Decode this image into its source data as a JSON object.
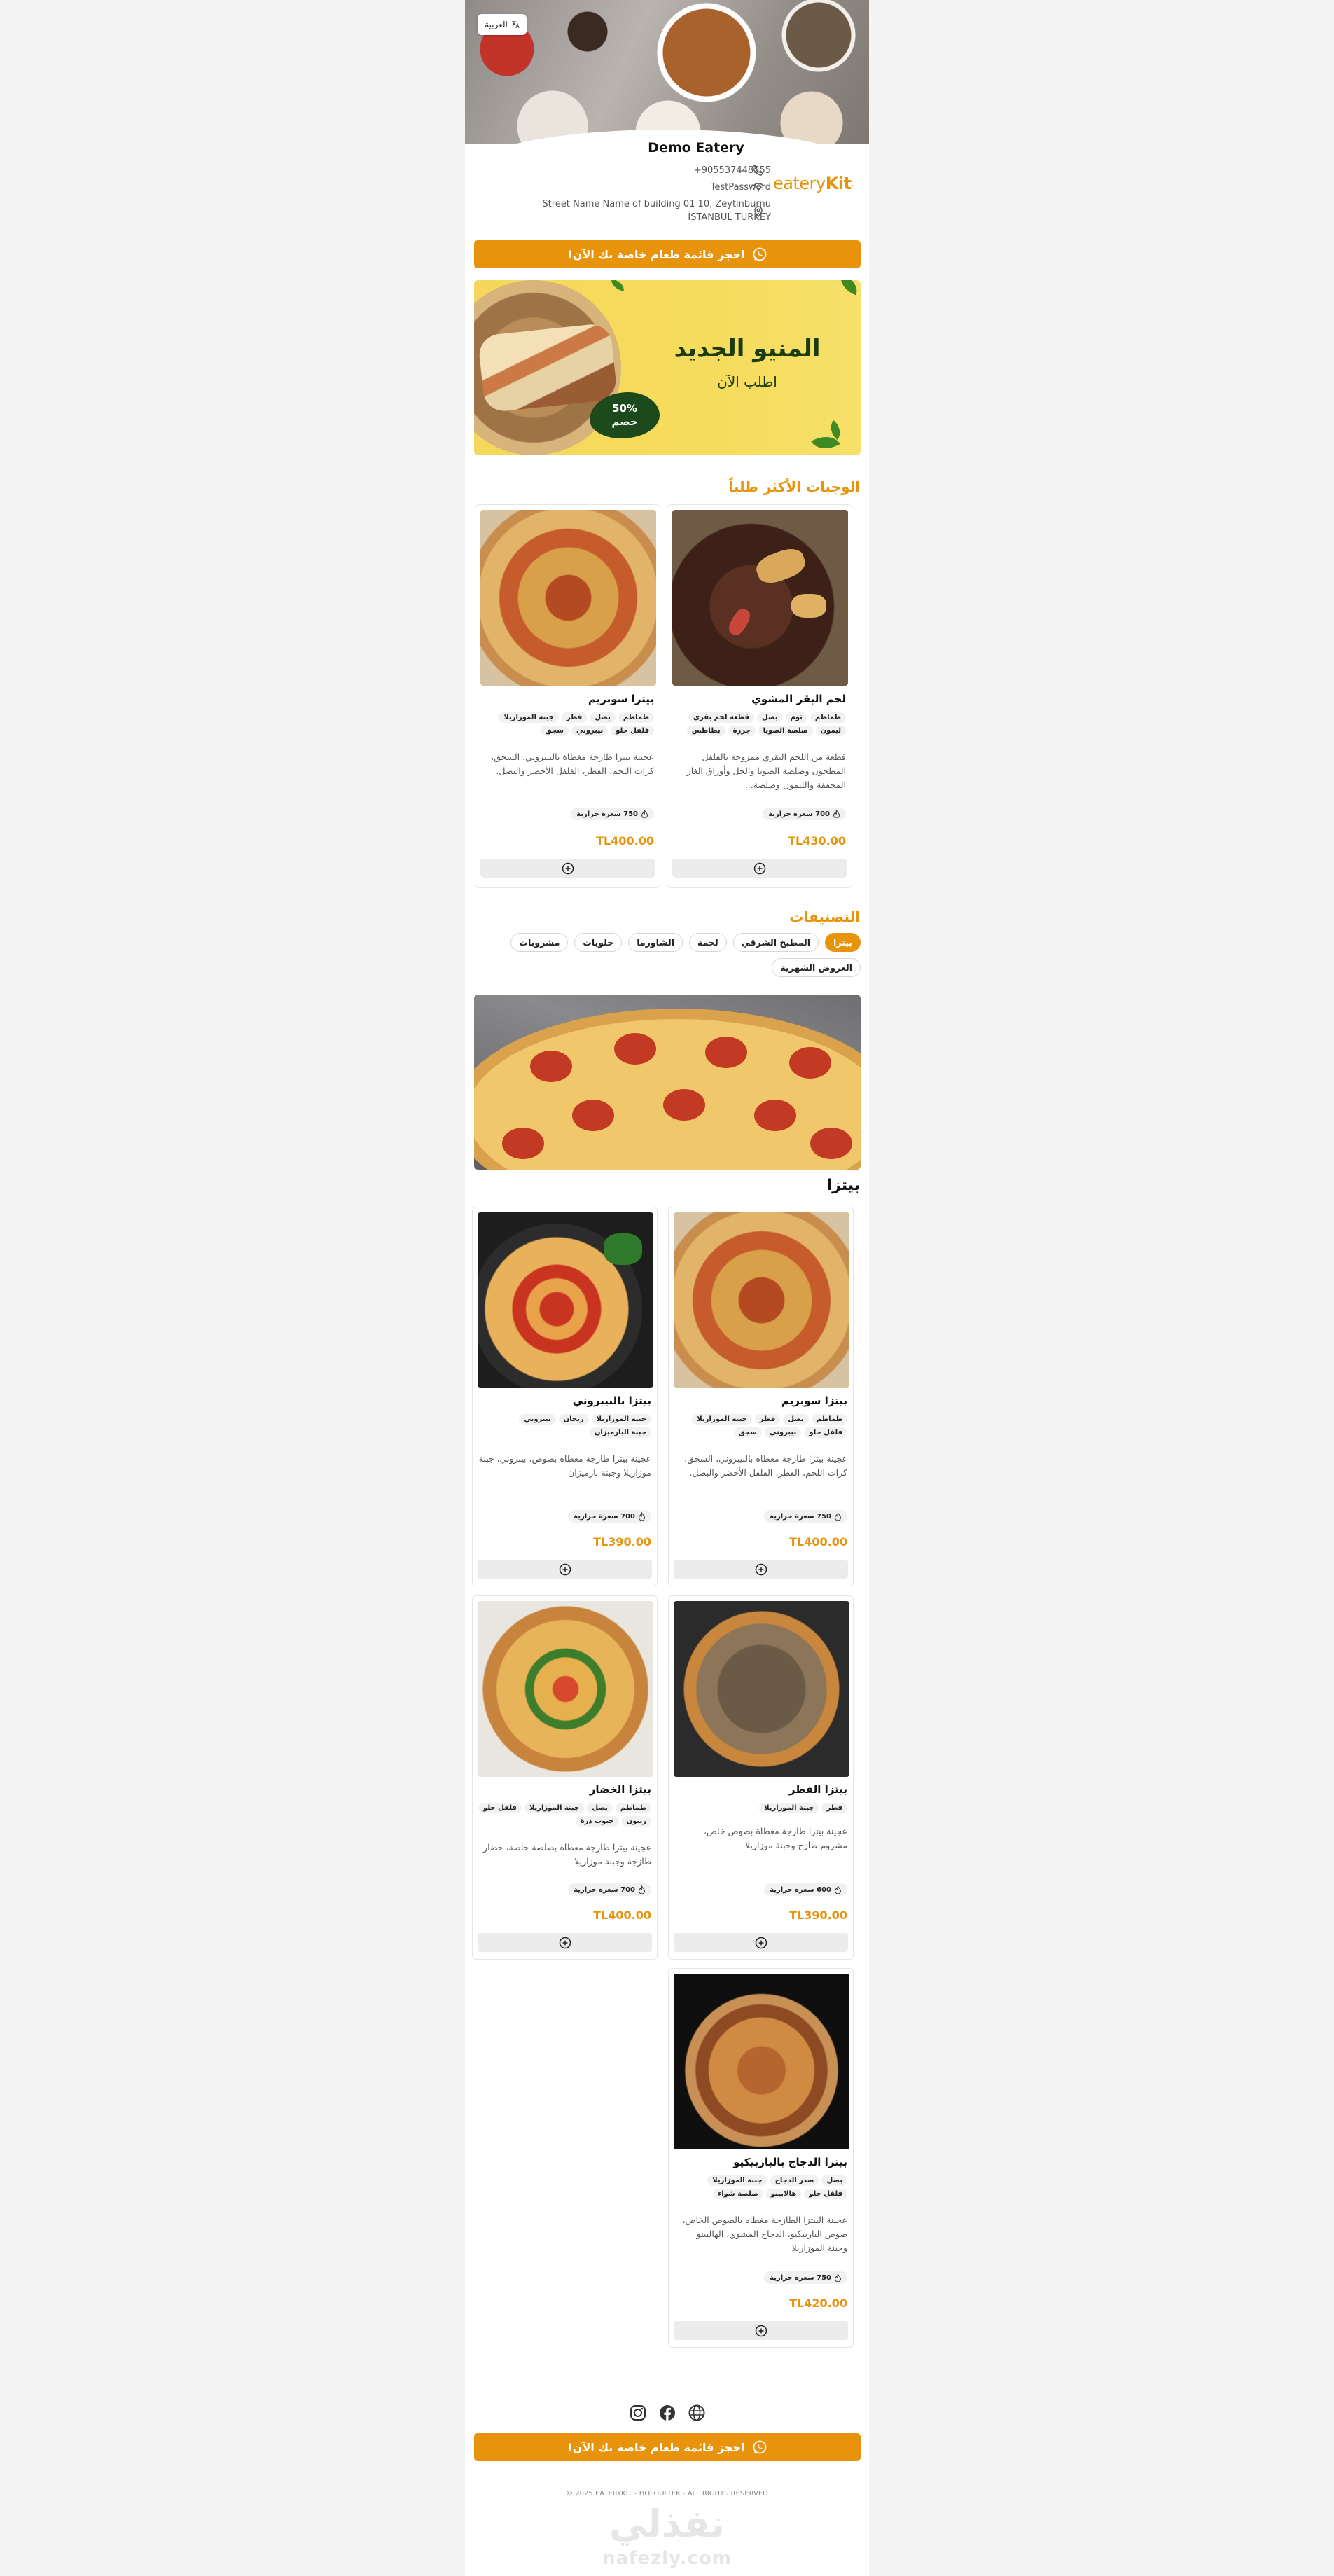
{
  "language_button": {
    "label": "العربية"
  },
  "restaurant": {
    "name": "Demo Eatery",
    "phone": "+905537448555",
    "wifi": "TestPassword",
    "address_line1": "Street Name Name of building 01 10, Zeytinburnu",
    "address_line2": "İSTANBUL TURKEY",
    "logo_light": "eatery",
    "logo_bold": "Kit"
  },
  "cta": {
    "label": "احجز قائمة طعام خاصة بك الآن!"
  },
  "banner": {
    "title": "المنيو الجديد",
    "subtitle": "اطلب الآن",
    "badge_line1": "50%",
    "badge_line2": "خصم"
  },
  "popular": {
    "title": "الوجبات الأكثر طلباً",
    "items": [
      {
        "name": "لحم البقر المشوي",
        "tags": [
          "طماطم",
          "ثوم",
          "بصل",
          "قطعة لحم بقري",
          "ليمون",
          "صلصة الصويا",
          "جزرة",
          "بطاطس"
        ],
        "desc": "قطعة من اللحم البقري ممزوجة بالفلفل المطحون وصلصة الصويا والخل وأوراق الغار المجففة والليمون وصلصة...",
        "calories": "700 سعرة حرارية",
        "price": "TL430.00"
      },
      {
        "name": "بيتزا سوبريم",
        "tags": [
          "طماطم",
          "بصل",
          "فطر",
          "جبنة الموزاريلا",
          "فلفل حلو",
          "بيبروني",
          "سجق"
        ],
        "desc": "عجينة بيتزا طازجة مغطاة بالبيبروني، السجق، كرات اللحم، الفطر، الفلفل الأخضر والبصل.",
        "calories": "750 سعرة حرارية",
        "price": "TL400.00"
      }
    ]
  },
  "categories": {
    "title": "التصنيفات",
    "chips": [
      "بيتزا",
      "المطبخ الشرقي",
      "لحمة",
      "الشاورما",
      "حلويات",
      "مشروبات",
      "العروض الشهرية"
    ],
    "active": "بيتزا",
    "section_heading": "بيتزا"
  },
  "menu": {
    "items": [
      {
        "name": "بيتزا سوبريم",
        "tags": [
          "طماطم",
          "بصل",
          "فطر",
          "جبنة الموزاريلا",
          "فلفل حلو",
          "بيبروني",
          "سجق"
        ],
        "desc": "عجينة بيتزا طازجة مغطاة بالبيبروني، السجق، كرات اللحم، الفطر، الفلفل الأخضر والبصل.",
        "calories": "750 سعرة حرارية",
        "price": "TL400.00"
      },
      {
        "name": "بيتزا بالبيبروني",
        "tags": [
          "جبنة الموزاريلا",
          "ريحان",
          "بيبروني",
          "جبنة البارميزان"
        ],
        "desc": "عجينة بيتزا طازجة مغطاة بصوص، بيبروني، جبنة موزاريلا وجبنة بارميزان",
        "calories": "700 سعرة حرارية",
        "price": "TL390.00"
      },
      {
        "name": "بيتزا الفطر",
        "tags": [
          "فطر",
          "جبنة الموزاريلا"
        ],
        "desc": "عجينة بيتزا طازجة مغطاة بصوص خاص، مشروم طازج وجبنة موزاريلا",
        "calories": "600 سعرة حرارية",
        "price": "TL390.00"
      },
      {
        "name": "بيتزا الخضار",
        "tags": [
          "طماطم",
          "بصل",
          "جبنة الموزاريلا",
          "فلفل حلو",
          "زيتون",
          "حبوب ذرة"
        ],
        "desc": "عجينة بيتزا طازجة مغطاة بصلصة خاصة، خضار طازجة وجبنة موزاريلا",
        "calories": "700 سعرة حرارية",
        "price": "TL400.00"
      },
      {
        "name": "بيتزا الدجاج بالباربيكيو",
        "tags": [
          "بصل",
          "صدر الدجاج",
          "جبنة الموزاريلا",
          "فلفل حلو",
          "هالابينو",
          "صلصة شواء"
        ],
        "desc": "عجينة البيتزا الطازجة مغطاه بالصوص الخاص، صوص الباربيكيو، الدجاج المشوي، الهالبينو وجبنة الموزاريلا",
        "calories": "750 سعرة حرارية",
        "price": "TL420.00"
      }
    ]
  },
  "footer": {
    "copyright": "© 2025 EATERYKIT - HOLOULTEK - ALL RIGHTS RESERVED",
    "watermark_ar": "نفذلي",
    "watermark_en": "nafezly.com"
  },
  "colors": {
    "accent": "#e8930c",
    "banner_bg": "#f6dc5c",
    "badge": "#1c4a1c"
  }
}
